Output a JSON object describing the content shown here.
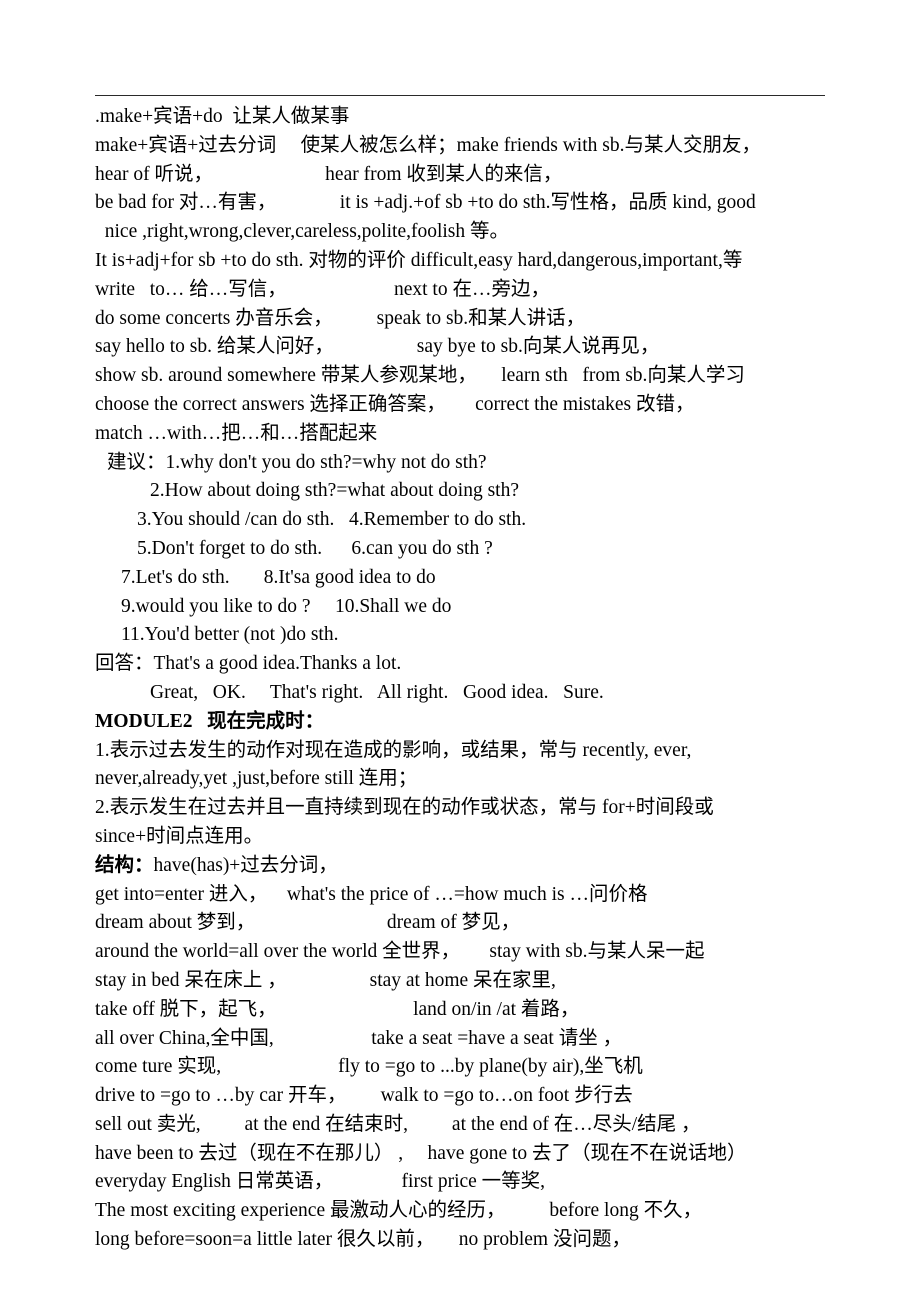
{
  "document": {
    "title": "英语笔记 MODULE2 现在完成时",
    "rule": {
      "name": "top-horizontal-rule"
    },
    "lines": [
      {
        "id": "l1",
        "text": ".make+宾语+do  让某人做某事"
      },
      {
        "id": "l2",
        "text": "make+宾语+过去分词     使某人被怎么样；make friends with sb.与某人交朋友，"
      },
      {
        "id": "l3",
        "text": "hear of 听说，                       hear from 收到某人的来信，"
      },
      {
        "id": "l4",
        "text": "be bad for 对…有害，             it is +adj.+of sb +to do sth.写性格，品质 kind, good"
      },
      {
        "id": "l5",
        "text": "  nice ,right,wrong,clever,careless,polite,foolish 等。"
      },
      {
        "id": "l6",
        "text": "It is+adj+for sb +to do sth. 对物的评价 difficult,easy hard,dangerous,important,等"
      },
      {
        "id": "l7",
        "text": "write   to… 给…写信，                      next to 在…旁边，"
      },
      {
        "id": "l8",
        "text": "do some concerts 办音乐会，         speak to sb.和某人讲话，"
      },
      {
        "id": "l9",
        "text": "say hello to sb. 给某人问好，                 say bye to sb.向某人说再见，"
      },
      {
        "id": "l10",
        "text": "show sb. around somewhere 带某人参观某地，     learn sth   from sb.向某人学习"
      },
      {
        "id": "l11",
        "text": "choose the correct answers 选择正确答案，      correct the mistakes 改错，"
      },
      {
        "id": "l12",
        "text": "match …with…把…和…搭配起来"
      },
      {
        "id": "l13",
        "text": "建议：1.why don't you do sth?=why not do sth?",
        "indent": 12
      },
      {
        "id": "l14",
        "text": "2.How about doing sth?=what about doing sth?",
        "indent": 55
      },
      {
        "id": "l15",
        "text": "3.You should /can do sth.   4.Remember to do sth.",
        "indent": 42
      },
      {
        "id": "l16",
        "text": "5.Don't forget to do sth.      6.can you do sth ?",
        "indent": 42
      },
      {
        "id": "l17",
        "text": "7.Let's do sth.       8.It'sa good idea to do",
        "indent": 26
      },
      {
        "id": "l18",
        "text": "9.would you like to do ?     10.Shall we do",
        "indent": 26
      },
      {
        "id": "l19",
        "text": "11.You'd better (not )do sth.",
        "indent": 26
      },
      {
        "id": "l20",
        "text": "回答：That's a good idea.Thanks a lot."
      },
      {
        "id": "l21",
        "text": "Great,   OK.     That's right.   All right.   Good idea.   Sure.",
        "indent": 55
      },
      {
        "id": "l22",
        "lead": "MODULE2   现在完成时：",
        "text": "",
        "bold_lead": true
      },
      {
        "id": "l23",
        "text": "1.表示过去发生的动作对现在造成的影响，或结果，常与 recently, ever,"
      },
      {
        "id": "l24",
        "text": "never,already,yet ,just,before still 连用；"
      },
      {
        "id": "l25",
        "text": "2.表示发生在过去并且一直持续到现在的动作或状态，常与 for+时间段或"
      },
      {
        "id": "l26",
        "text": "since+时间点连用。"
      },
      {
        "id": "l27",
        "lead": "结构：",
        "text": "have(has)+过去分词，",
        "bold_lead": true
      },
      {
        "id": "l28",
        "text": "get into=enter 进入，    what's the price of …=how much is …问价格"
      },
      {
        "id": "l29",
        "text": "dream about 梦到，                           dream of 梦见，"
      },
      {
        "id": "l30",
        "text": "around the world=all over the world 全世界，      stay with sb.与某人呆一起"
      },
      {
        "id": "l31",
        "text": "stay in bed 呆在床上 ，                 stay at home 呆在家里,"
      },
      {
        "id": "l32",
        "text": "take off 脱下，起飞，                            land on/in /at 着路，"
      },
      {
        "id": "l33",
        "text": "all over China,全中国,                    take a seat =have a seat 请坐 ，"
      },
      {
        "id": "l34",
        "text": "come ture 实现,                        fly to =go to ...by plane(by air),坐飞机"
      },
      {
        "id": "l35",
        "text": "drive to =go to …by car 开车，       walk to =go to…on foot 步行去"
      },
      {
        "id": "l36",
        "text": "sell out 卖光,         at the end 在结束时,         at the end of 在…尽头/结尾 ，"
      },
      {
        "id": "l37",
        "text": "have been to 去过（现在不在那儿） ,     have gone to 去了（现在不在说话地）"
      },
      {
        "id": "l38",
        "text": "everyday English 日常英语，              first price 一等奖,"
      },
      {
        "id": "l39",
        "text": "The most exciting experience 最激动人心的经历，         before long 不久，"
      },
      {
        "id": "l40",
        "text": "long before=soon=a little later 很久以前，     no problem 没问题，"
      }
    ]
  }
}
